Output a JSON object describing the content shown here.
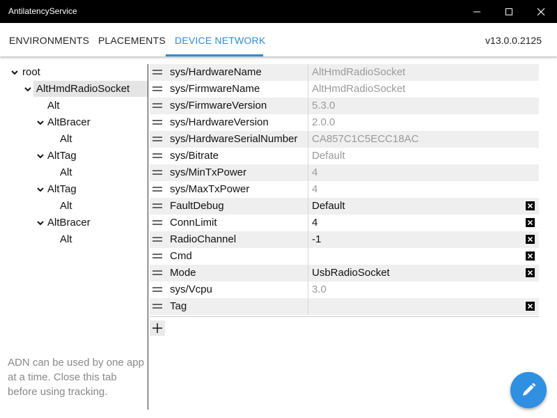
{
  "window": {
    "title": "AntilatencyService"
  },
  "nav": {
    "tabs": [
      "ENVIRONMENTS",
      "PLACEMENTS",
      "DEVICE NETWORK"
    ],
    "active_tab": "DEVICE NETWORK",
    "version": "v13.0.0.2125"
  },
  "tree": [
    {
      "label": "root",
      "expanded": true
    },
    {
      "label": "AltHmdRadioSocket",
      "expanded": true,
      "selected": true
    },
    {
      "label": "Alt"
    },
    {
      "label": "AltBracer",
      "expanded": true
    },
    {
      "label": "Alt"
    },
    {
      "label": "AltTag",
      "expanded": true
    },
    {
      "label": "Alt"
    },
    {
      "label": "AltTag",
      "expanded": true
    },
    {
      "label": "Alt"
    },
    {
      "label": "AltBracer",
      "expanded": true
    },
    {
      "label": "Alt"
    }
  ],
  "note": "ADN can be used by one app at a time. Close this tab before using tracking.",
  "properties": [
    {
      "key": "sys/HardwareName",
      "value": "AltHmdRadioSocket",
      "readonly": true
    },
    {
      "key": "sys/FirmwareName",
      "value": "AltHmdRadioSocket",
      "readonly": true
    },
    {
      "key": "sys/FirmwareVersion",
      "value": "5.3.0",
      "readonly": true
    },
    {
      "key": "sys/HardwareVersion",
      "value": "2.0.0",
      "readonly": true
    },
    {
      "key": "sys/HardwareSerialNumber",
      "value": "CA857C1C5ECC18AC",
      "readonly": true
    },
    {
      "key": "sys/Bitrate",
      "value": "Default",
      "readonly": true
    },
    {
      "key": "sys/MinTxPower",
      "value": "4",
      "readonly": true
    },
    {
      "key": "sys/MaxTxPower",
      "value": "4",
      "readonly": true
    },
    {
      "key": "FaultDebug",
      "value": "Default",
      "readonly": false
    },
    {
      "key": "ConnLimit",
      "value": "4",
      "readonly": false
    },
    {
      "key": "RadioChannel",
      "value": "-1",
      "readonly": false
    },
    {
      "key": "Cmd",
      "value": "",
      "readonly": false
    },
    {
      "key": "Mode",
      "value": "UsbRadioSocket",
      "readonly": false
    },
    {
      "key": "sys/Vcpu",
      "value": "3.0",
      "readonly": true
    },
    {
      "key": "Tag",
      "value": "",
      "readonly": false
    }
  ],
  "colors": {
    "accent": "#2e8bd6",
    "fab": "#2f8fe0",
    "titlebar": "#000000"
  },
  "icons": {
    "add": "plus-icon",
    "fab": "pencil-icon",
    "delete": "close-box-icon",
    "drag": "drag-handle-icon"
  }
}
